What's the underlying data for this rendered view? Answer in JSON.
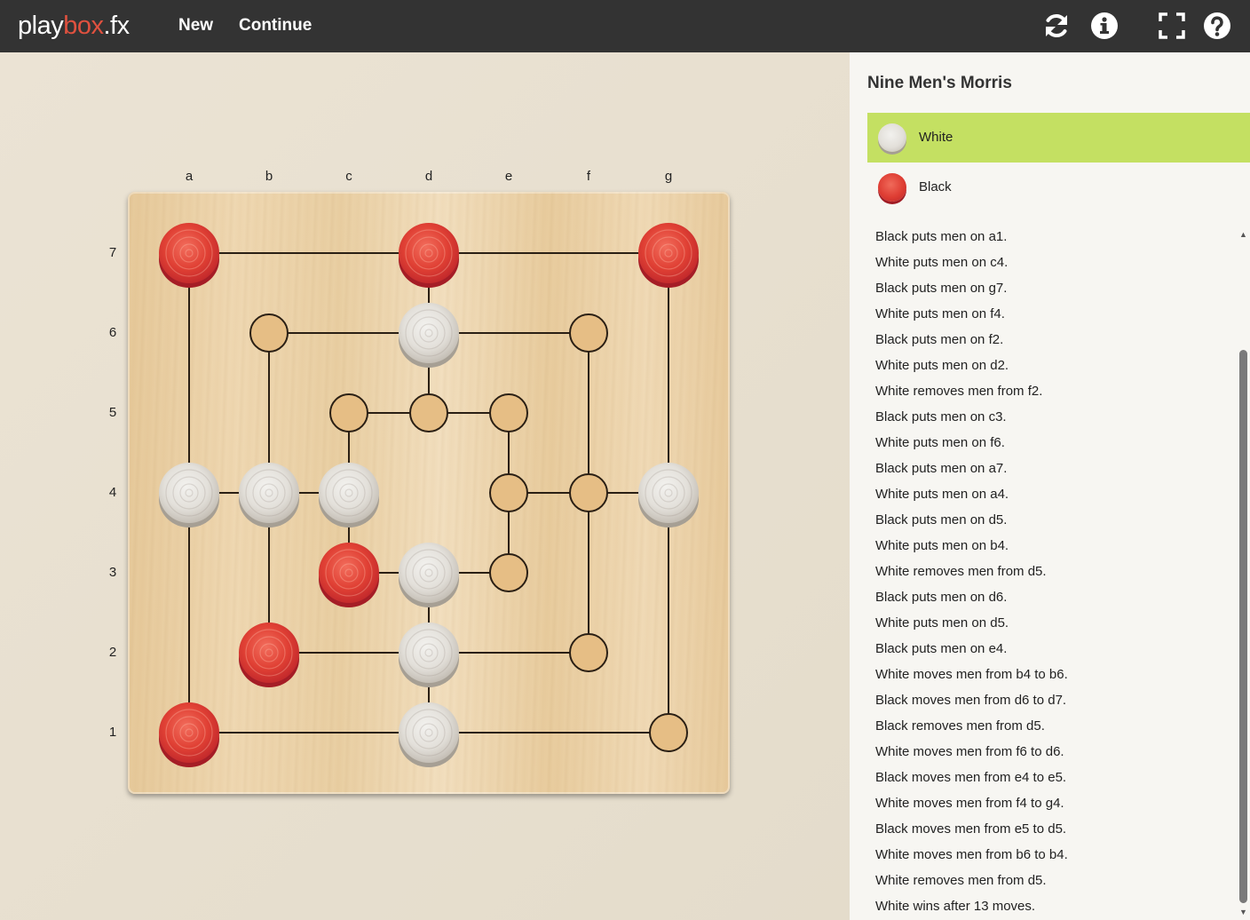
{
  "header": {
    "logo": {
      "part1": "play",
      "part2": "box",
      "part3": ".fx"
    },
    "nav": {
      "new_label": "New",
      "continue_label": "Continue"
    },
    "icons": [
      "refresh-icon",
      "info-icon",
      "fullscreen-icon",
      "help-icon"
    ]
  },
  "board": {
    "columns": [
      "a",
      "b",
      "c",
      "d",
      "e",
      "f",
      "g"
    ],
    "rows": [
      "7",
      "6",
      "5",
      "4",
      "3",
      "2",
      "1"
    ],
    "pieces": [
      {
        "square": "a7",
        "color": "black"
      },
      {
        "square": "d7",
        "color": "black"
      },
      {
        "square": "g7",
        "color": "black"
      },
      {
        "square": "d6",
        "color": "white"
      },
      {
        "square": "a4",
        "color": "white"
      },
      {
        "square": "b4",
        "color": "white"
      },
      {
        "square": "c4",
        "color": "white"
      },
      {
        "square": "g4",
        "color": "white"
      },
      {
        "square": "c3",
        "color": "black"
      },
      {
        "square": "d3",
        "color": "white"
      },
      {
        "square": "b2",
        "color": "black"
      },
      {
        "square": "d2",
        "color": "white"
      },
      {
        "square": "a1",
        "color": "black"
      },
      {
        "square": "d1",
        "color": "white"
      }
    ],
    "empty_points": [
      "b6",
      "f6",
      "c5",
      "d5",
      "e5",
      "e4",
      "f4",
      "e3",
      "f2",
      "g1"
    ]
  },
  "sidebar": {
    "game_title": "Nine Men's Morris",
    "players": {
      "white_label": "White",
      "black_label": "Black"
    },
    "active_player": "white",
    "log": [
      "Black puts men on a1.",
      "White puts men on c4.",
      "Black puts men on g7.",
      "White puts men on f4.",
      "Black puts men on f2.",
      "White puts men on d2.",
      "White removes men from f2.",
      "Black puts men on c3.",
      "White puts men on f6.",
      "Black puts men on a7.",
      "White puts men on a4.",
      "Black puts men on d5.",
      "White puts men on b4.",
      "White removes men from d5.",
      "Black puts men on d6.",
      "White puts men on d5.",
      "Black puts men on e4.",
      "White moves men from b4 to b6.",
      "Black moves men from d6 to d7.",
      "Black removes men from d5.",
      "White moves men from f6 to d6.",
      "Black moves men from e4 to e5.",
      "White moves men from f4 to g4.",
      "Black moves men from e5 to d5.",
      "White moves men from b6 to b4.",
      "White removes men from d5.",
      "White wins after 13 moves."
    ]
  },
  "colors": {
    "header_bg": "#333333",
    "logo_accent": "#e0513f",
    "active_player_bg": "#c4e062",
    "white_piece": "#e6e3de",
    "black_piece": "#de3d33",
    "point_fill": "#e6be85"
  }
}
